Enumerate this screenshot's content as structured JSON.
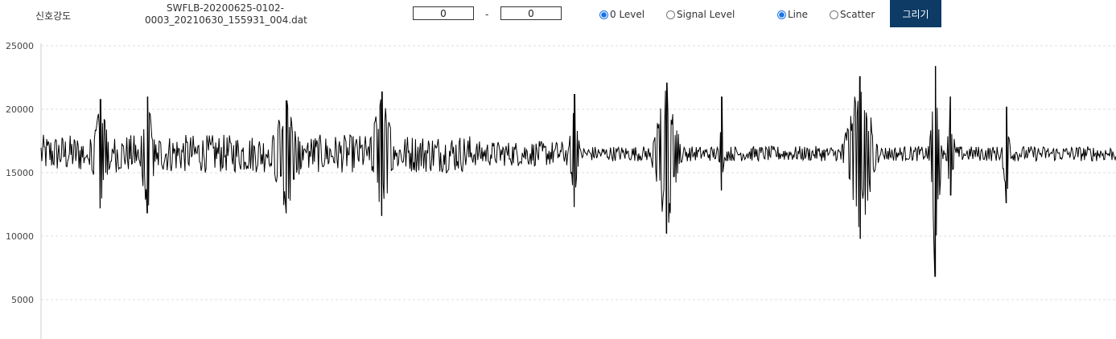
{
  "toolbar": {
    "title": "신호강도",
    "filename_line1": "SWFLB-20200625-0102-",
    "filename_line2": "0003_20210630_155931_004.dat",
    "range_start": "0",
    "range_separator": "-",
    "range_end": "0",
    "level_options": [
      {
        "label": "0 Level",
        "checked": true
      },
      {
        "label": "Signal Level",
        "checked": false
      }
    ],
    "plot_options": [
      {
        "label": "Line",
        "checked": true
      },
      {
        "label": "Scatter",
        "checked": false
      }
    ],
    "draw_button": "그리기"
  },
  "colors": {
    "accent": "#0d3b66",
    "radio_checked": "#1a73e8",
    "trace": "#000000",
    "grid": "#dddddd"
  },
  "chart_data": {
    "type": "line",
    "ylim": [
      2500,
      25000
    ],
    "yticks": [
      "25000",
      "20000",
      "15000",
      "10000",
      "5000"
    ],
    "grid": true,
    "baseline": 16500,
    "n_samples": 1330,
    "noise_amplitude": [
      {
        "from": 0.0,
        "to": 0.4,
        "amp": 1500
      },
      {
        "from": 0.4,
        "to": 0.5,
        "amp": 1000
      },
      {
        "from": 0.5,
        "to": 1.0,
        "amp": 600
      }
    ],
    "bursts": [
      {
        "x": 0.055,
        "peak": 20800,
        "trough": 12200,
        "width": 0.008
      },
      {
        "x": 0.099,
        "peak": 21000,
        "trough": 11800,
        "width": 0.006
      },
      {
        "x": 0.228,
        "peak": 20700,
        "trough": 11800,
        "width": 0.012
      },
      {
        "x": 0.317,
        "peak": 21400,
        "trough": 11600,
        "width": 0.009
      },
      {
        "x": 0.496,
        "peak": 21200,
        "trough": 12300,
        "width": 0.004
      },
      {
        "x": 0.582,
        "peak": 22100,
        "trough": 10200,
        "width": 0.01
      },
      {
        "x": 0.633,
        "peak": 21000,
        "trough": 13600,
        "width": 0.002
      },
      {
        "x": 0.762,
        "peak": 22600,
        "trough": 9800,
        "width": 0.012
      },
      {
        "x": 0.832,
        "peak": 23400,
        "trough": 6800,
        "width": 0.004
      },
      {
        "x": 0.846,
        "peak": 21000,
        "trough": 13200,
        "width": 0.003
      },
      {
        "x": 0.898,
        "peak": 20200,
        "trough": 12600,
        "width": 0.003
      }
    ]
  }
}
